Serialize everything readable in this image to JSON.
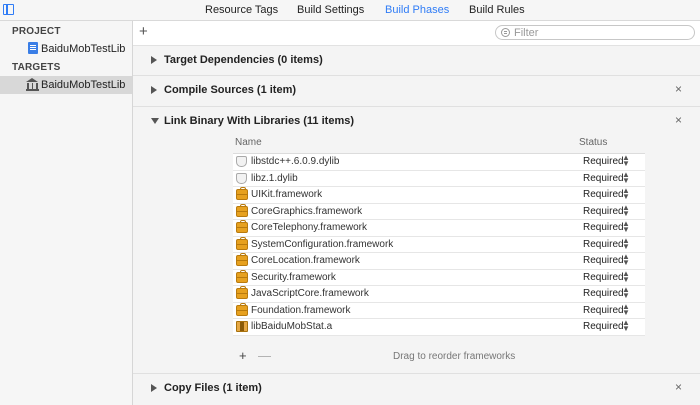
{
  "tabs": [
    {
      "label": "Resource Tags",
      "active": false
    },
    {
      "label": "Build Settings",
      "active": false
    },
    {
      "label": "Build Phases",
      "active": true
    },
    {
      "label": "Build Rules",
      "active": false
    }
  ],
  "sidebar": {
    "project_header": "PROJECT",
    "project_item": "BaiduMobTestLib",
    "targets_header": "TARGETS",
    "target_item": "BaiduMobTestLib"
  },
  "toolbar": {
    "add_symbol": "+",
    "filter_placeholder": "Filter"
  },
  "phases": {
    "target_dependencies": {
      "title": "Target Dependencies (0 items)"
    },
    "compile_sources": {
      "title": "Compile Sources (1 item)",
      "close": "×"
    },
    "link_binary": {
      "title": "Link Binary With Libraries (11 items)",
      "close": "×",
      "col_name": "Name",
      "col_status": "Status",
      "rows": [
        {
          "name": "libstdc++.6.0.9.dylib",
          "status": "Required",
          "icon": "dylib-icon"
        },
        {
          "name": "libz.1.dylib",
          "status": "Required",
          "icon": "dylib-icon"
        },
        {
          "name": "UIKit.framework",
          "status": "Required",
          "icon": "framework-icon"
        },
        {
          "name": "CoreGraphics.framework",
          "status": "Required",
          "icon": "framework-icon"
        },
        {
          "name": "CoreTelephony.framework",
          "status": "Required",
          "icon": "framework-icon"
        },
        {
          "name": "SystemConfiguration.framework",
          "status": "Required",
          "icon": "framework-icon"
        },
        {
          "name": "CoreLocation.framework",
          "status": "Required",
          "icon": "framework-icon"
        },
        {
          "name": "Security.framework",
          "status": "Required",
          "icon": "framework-icon"
        },
        {
          "name": "JavaScriptCore.framework",
          "status": "Required",
          "icon": "framework-icon"
        },
        {
          "name": "Foundation.framework",
          "status": "Required",
          "icon": "framework-icon"
        },
        {
          "name": "libBaiduMobStat.a",
          "status": "Required",
          "icon": "static-library-icon"
        }
      ],
      "add": "+",
      "remove": "—",
      "hint": "Drag to reorder frameworks"
    },
    "copy_files": {
      "title": "Copy Files (1 item)",
      "close": "×"
    }
  }
}
